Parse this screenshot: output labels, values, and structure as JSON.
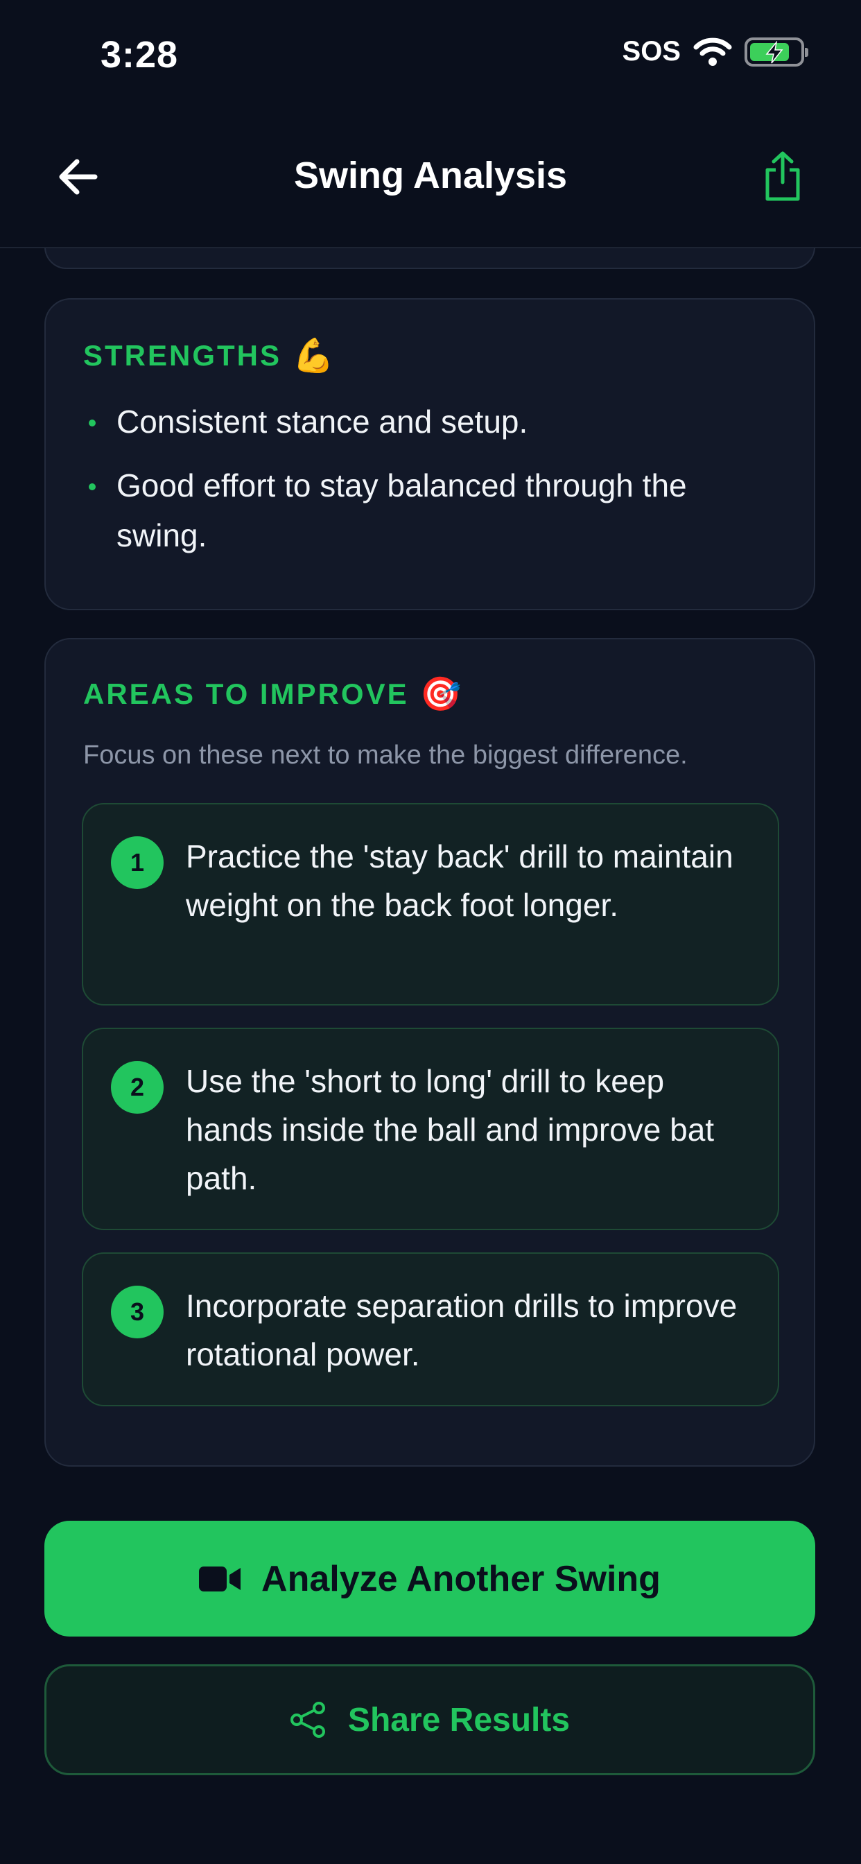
{
  "status_bar": {
    "time": "3:28",
    "carrier": "SOS",
    "battery_level": 0.8
  },
  "nav": {
    "title": "Swing Analysis",
    "back_icon": "arrow-left-icon",
    "share_icon": "share-up-icon"
  },
  "strengths": {
    "title": "STRENGTHS",
    "emoji": "💪",
    "items": [
      "Consistent stance and setup.",
      "Good effort to stay balanced through the swing."
    ]
  },
  "improve": {
    "title": "AREAS TO IMPROVE",
    "emoji": "🎯",
    "subtitle": "Focus on these next to make the biggest difference.",
    "tips": [
      {
        "num": "1",
        "text": "Practice the 'stay back' drill to maintain weight on the back foot longer."
      },
      {
        "num": "2",
        "text": "Use the 'short to long' drill to keep hands inside the ball and improve bat path."
      },
      {
        "num": "3",
        "text": "Incorporate separation drills to improve rotational power."
      }
    ]
  },
  "actions": {
    "analyze_label": "Analyze Another Swing",
    "analyze_icon": "video-camera-icon",
    "share_label": "Share Results",
    "share_icon": "share-nodes-icon"
  },
  "colors": {
    "accent": "#22c55e",
    "background": "#0a0f1c",
    "card": "#121828"
  }
}
